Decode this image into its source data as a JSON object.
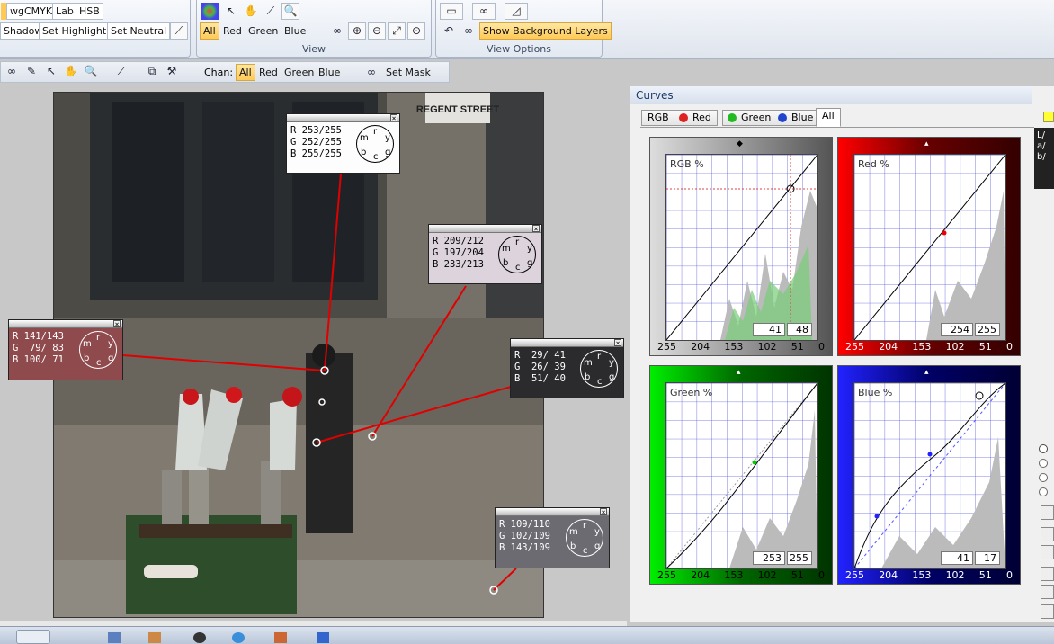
{
  "ribbon": {
    "mode_group": {
      "buttons": [
        "wgCMYK",
        "Lab",
        "HSB"
      ],
      "row2": [
        "Shadow",
        "Set Highlight",
        "Set Neutral"
      ]
    },
    "view_group": {
      "title": "View",
      "channels": [
        "All",
        "Red",
        "Green",
        "Blue"
      ]
    },
    "view_options_group": {
      "title": "View Options",
      "show_bg_label": "Show Background Layers"
    }
  },
  "toolbar2": {
    "chan_label": "Chan:",
    "channels": [
      "All",
      "Red",
      "Green",
      "Blue"
    ],
    "set_mask_label": "Set Mask"
  },
  "probes": [
    {
      "rows": [
        "R 253/255",
        "G 252/255",
        "B 255/255"
      ]
    },
    {
      "rows": [
        "R 209/212",
        "G 197/204",
        "B 233/213"
      ]
    },
    {
      "rows": [
        "R 141/143",
        "G  79/ 83",
        "B 100/ 71"
      ]
    },
    {
      "rows": [
        "R  29/ 41",
        "G  26/ 39",
        "B  51/ 40"
      ]
    },
    {
      "rows": [
        "R 109/110",
        "G 102/109",
        "B 143/109"
      ]
    }
  ],
  "dial_letters": [
    "r",
    "y",
    "g",
    "c",
    "b",
    "m"
  ],
  "photo_sign": "REGENT STREET",
  "curves": {
    "title": "Curves",
    "tabs": [
      "RGB",
      "Red",
      "Green",
      "Blue",
      "All"
    ],
    "axis_ticks": [
      "255",
      "204",
      "153",
      "102",
      "51",
      "0"
    ],
    "panels": [
      {
        "label": "RGB %",
        "in": "41",
        "out": "48"
      },
      {
        "label": "Red %",
        "in": "254",
        "out": "255"
      },
      {
        "label": "Green %",
        "in": "253",
        "out": "255"
      },
      {
        "label": "Blue %",
        "in": "41",
        "out": "17"
      }
    ],
    "side_label": "L/ a/ b/"
  },
  "colors": {
    "accent": "#ffc956",
    "red_line": "#e00000",
    "grid": "#5b5bd6"
  }
}
